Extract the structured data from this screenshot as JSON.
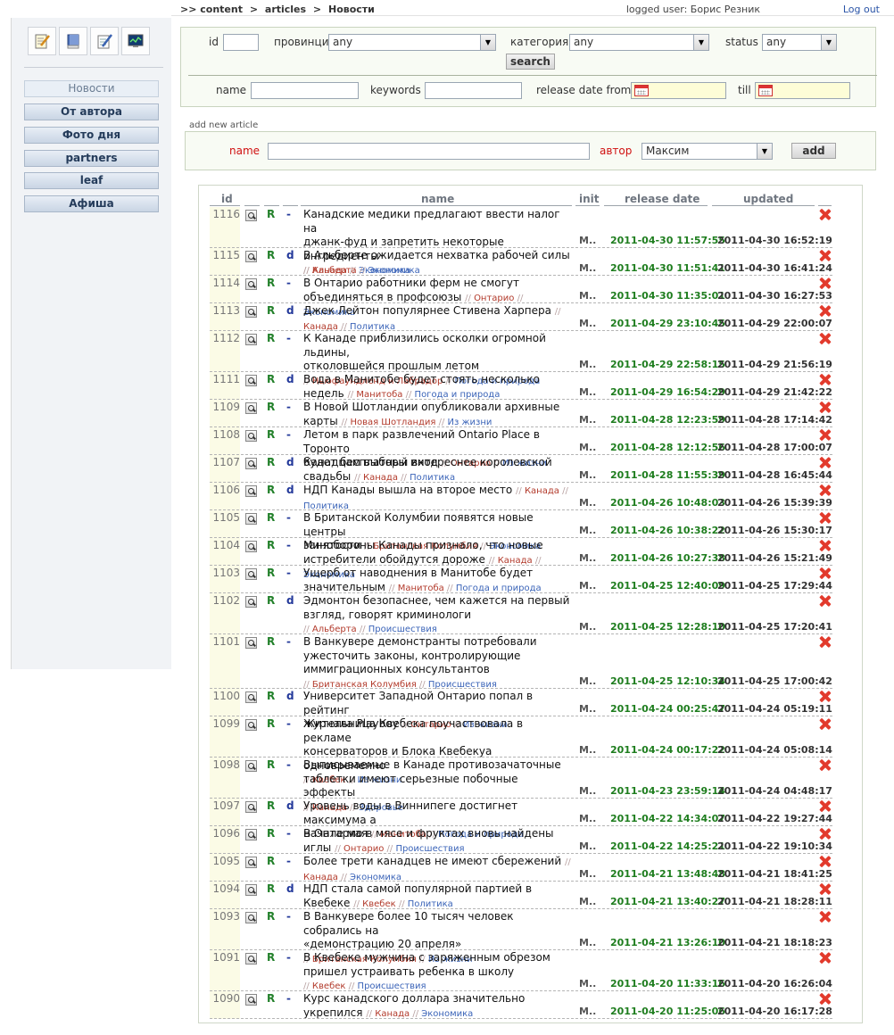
{
  "breadcrumb": [
    ">> content",
    ">",
    "articles",
    ">",
    "Новости"
  ],
  "user": {
    "label": "logged user: Борис Резник",
    "logout": "Log out"
  },
  "sidebar": {
    "nav": [
      "Новости",
      "От автора",
      "Фото дня",
      "partners",
      "leaf",
      "Афиша"
    ],
    "active": "Новости",
    "tools": [
      "edit-note-icon",
      "book-icon",
      "pencil-list-icon",
      "monitor-chart-icon"
    ]
  },
  "filter": {
    "id_label": "id",
    "province_label": "провинци",
    "province_value": "any",
    "category_label": "категория",
    "category_value": "any",
    "status_label": "status",
    "status_value": "any",
    "search_label": "search",
    "name_label": "name",
    "keywords_label": "keywords",
    "release_from_label": "release date from",
    "till_label": "till"
  },
  "add": {
    "section_label": "add new article",
    "name_label": "name",
    "author_label": "автор",
    "author_value": "Максим",
    "add_label": "add"
  },
  "table": {
    "columns": [
      "id",
      "name",
      "init",
      "release date",
      "updated"
    ],
    "rows": [
      {
        "id": "1116",
        "d": "-",
        "title": [
          "Канадские медики предлагают ввести налог на",
          "джанк-фуд и запретить некоторые ингредиенты"
        ],
        "tags": [
          "Канада",
          "Экономика"
        ],
        "init": "M..",
        "release": "2011-04-30 11:57:55",
        "updated": "2011-04-30 16:52:19"
      },
      {
        "id": "1115",
        "d": "d",
        "title": [
          "В Альберте ожидается нехватка рабочей силы"
        ],
        "tags": [
          "Альберта",
          "Экономика"
        ],
        "init": "M..",
        "release": "2011-04-30 11:51:41",
        "updated": "2011-04-30 16:41:24"
      },
      {
        "id": "1114",
        "d": "-",
        "title": [
          "В Онтарио работники ферм не смогут",
          "объединяться в профсоюзы"
        ],
        "tags": [
          "Онтарио",
          "Экономика"
        ],
        "init": "M..",
        "release": "2011-04-30 11:35:01",
        "updated": "2011-04-30 16:27:53"
      },
      {
        "id": "1113",
        "d": "d",
        "title": [
          "Джек Лейтон популярнее Стивена Харпера"
        ],
        "tags": [
          "Канада",
          "Политика"
        ],
        "init": "M..",
        "release": "2011-04-29 23:10:45",
        "updated": "2011-04-29 22:00:07"
      },
      {
        "id": "1112",
        "d": "-",
        "title": [
          "К Канаде приблизились осколки огромной льдины,",
          "отколовшейся прошлым летом"
        ],
        "tags": [
          "Ньюфаундленд и Лабрадор",
          "Погода и природа"
        ],
        "init": "M..",
        "release": "2011-04-29 22:58:15",
        "updated": "2011-04-29 21:56:19"
      },
      {
        "id": "1111",
        "d": "d",
        "title": [
          "Вода в Манитобе будет стоять несколько недель"
        ],
        "tags": [
          "Манитоба",
          "Погода и природа"
        ],
        "init": "M..",
        "release": "2011-04-29 16:54:29",
        "updated": "2011-04-29 21:42:22"
      },
      {
        "id": "1109",
        "d": "-",
        "title": [
          "В Новой Шотландии опубликовали архивные карты"
        ],
        "tags": [
          "Новая Шотландия",
          "Из жизни"
        ],
        "init": "M..",
        "release": "2011-04-28 12:23:59",
        "updated": "2011-04-28 17:14:42"
      },
      {
        "id": "1108",
        "d": "-",
        "title": [
          "Летом в парк развлечений Ontario Place в Торонто",
          "будет бесплатный вход"
        ],
        "tags": [
          "Онтарио",
          "Из жизни"
        ],
        "init": "M..",
        "release": "2011-04-28 12:12:56",
        "updated": "2011-04-28 17:00:07"
      },
      {
        "id": "1107",
        "d": "d",
        "title": [
          "Канадцам выборы интереснее королевской",
          "свадьбы"
        ],
        "tags": [
          "Канада",
          "Политика"
        ],
        "init": "M..",
        "release": "2011-04-28 11:55:39",
        "updated": "2011-04-28 16:45:44"
      },
      {
        "id": "1106",
        "d": "d",
        "title": [
          "НДП Канады вышла на второе место"
        ],
        "tags": [
          "Канада",
          "Политика"
        ],
        "init": "M..",
        "release": "2011-04-26 10:48:03",
        "updated": "2011-04-26 15:39:39"
      },
      {
        "id": "1105",
        "d": "-",
        "title": [
          "В Британской Колумбии появятся новые центры",
          "занятости"
        ],
        "tags": [
          "Британская Колумбия",
          "Экономика"
        ],
        "init": "M..",
        "release": "2011-04-26 10:38:22",
        "updated": "2011-04-26 15:30:17"
      },
      {
        "id": "1104",
        "d": "-",
        "title": [
          "Минобороны Канады признало, что новые",
          "истребители обойдутся дороже"
        ],
        "tags": [
          "Канада",
          "Экономика"
        ],
        "init": "M..",
        "release": "2011-04-26 10:27:38",
        "updated": "2011-04-26 15:21:49"
      },
      {
        "id": "1103",
        "d": "-",
        "title": [
          "Ущерб от наводнения в Манитобе будет",
          "значительным"
        ],
        "tags": [
          "Манитоба",
          "Погода и природа"
        ],
        "init": "M..",
        "release": "2011-04-25 12:40:09",
        "updated": "2011-04-25 17:29:44"
      },
      {
        "id": "1102",
        "d": "d",
        "title": [
          "Эдмонтон безопаснее, чем кажется на первый",
          "взгляд, говорят криминологи"
        ],
        "tags": [
          "Альберта",
          "Происшествия"
        ],
        "init": "M..",
        "release": "2011-04-25 12:28:10",
        "updated": "2011-04-25 17:20:41"
      },
      {
        "id": "1101",
        "d": "-",
        "title": [
          "В Ванкувере демонстранты потребовали",
          "ужесточить законы, контролирующие",
          "иммиграционных консультантов"
        ],
        "tags": [
          "Британская Колумбия",
          "Происшествия"
        ],
        "init": "M..",
        "release": "2011-04-25 12:10:34",
        "updated": "2011-04-25 17:00:42"
      },
      {
        "id": "1100",
        "d": "d",
        "title": [
          "Университет Западной Онтарио попал в рейтинг",
          "журнала Playboy"
        ],
        "tags": [
          "Онтарио",
          "Из жизни"
        ],
        "init": "M..",
        "release": "2011-04-24 00:25:47",
        "updated": "2011-04-24 05:19:11"
      },
      {
        "id": "1099",
        "d": "-",
        "title": [
          "Жительница Квебека поучаствовала в рекламе",
          "консерваторов и Блока Квебекуа одновременно"
        ],
        "tags": [
          "Квебек",
          "Из жизни"
        ],
        "init": "M..",
        "release": "2011-04-24 00:17:22",
        "updated": "2011-04-24 05:08:14"
      },
      {
        "id": "1098",
        "d": "-",
        "title": [
          "Выписываемые в Канаде противозачаточные",
          "таблетки имеют серьезные побочные эффекты"
        ],
        "tags": [
          "Канада",
          "Здоровье"
        ],
        "init": "M..",
        "release": "2011-04-23 23:59:14",
        "updated": "2011-04-24 04:48:17"
      },
      {
        "id": "1097",
        "d": "d",
        "title": [
          "Уровень воды в Виннипеге достигнет максимума а",
          "начале мая"
        ],
        "tags": [
          "Манитоба",
          "Погода и природа"
        ],
        "init": "M..",
        "release": "2011-04-22 14:34:07",
        "updated": "2011-04-22 19:27:44"
      },
      {
        "id": "1096",
        "d": "-",
        "title": [
          "В Онтарио в мясе и фруктах вновь найдены иглы"
        ],
        "tags": [
          "Онтарио",
          "Происшествия"
        ],
        "init": "M..",
        "release": "2011-04-22 14:25:21",
        "updated": "2011-04-22 19:10:34"
      },
      {
        "id": "1095",
        "d": "-",
        "title": [
          "Более трети канадцев не имеют сбережений"
        ],
        "tags": [
          "Канада",
          "Экономика"
        ],
        "init": "M..",
        "release": "2011-04-21 13:48:48",
        "updated": "2011-04-21 18:41:25"
      },
      {
        "id": "1094",
        "d": "d",
        "title": [
          "НДП стала самой популярной партией в Квебеке"
        ],
        "tags": [
          "Квебек",
          "Политика"
        ],
        "init": "M..",
        "release": "2011-04-21 13:40:27",
        "updated": "2011-04-21 18:28:11"
      },
      {
        "id": "1093",
        "d": "-",
        "title": [
          "В Ванкувере более 10 тысяч человек собрались на",
          "«демонстрацию 20 апреля»"
        ],
        "tags": [
          "Британская Колумбия",
          "Из жизни"
        ],
        "init": "M..",
        "release": "2011-04-21 13:26:10",
        "updated": "2011-04-21 18:18:23"
      },
      {
        "id": "1091",
        "d": "-",
        "title": [
          "В Квебеке мужчина с заряженным обрезом",
          "пришел устраивать ребенка в школу"
        ],
        "tags": [
          "Квебек",
          "Происшествия"
        ],
        "init": "M..",
        "release": "2011-04-20 11:33:16",
        "updated": "2011-04-20 16:26:04"
      },
      {
        "id": "1090",
        "d": "-",
        "title": [
          "Курс канадского доллара значительно укрепился"
        ],
        "tags": [
          "Канада",
          "Экономика"
        ],
        "init": "M..",
        "release": "2011-04-20 11:25:06",
        "updated": "2011-04-20 16:17:28"
      }
    ]
  }
}
